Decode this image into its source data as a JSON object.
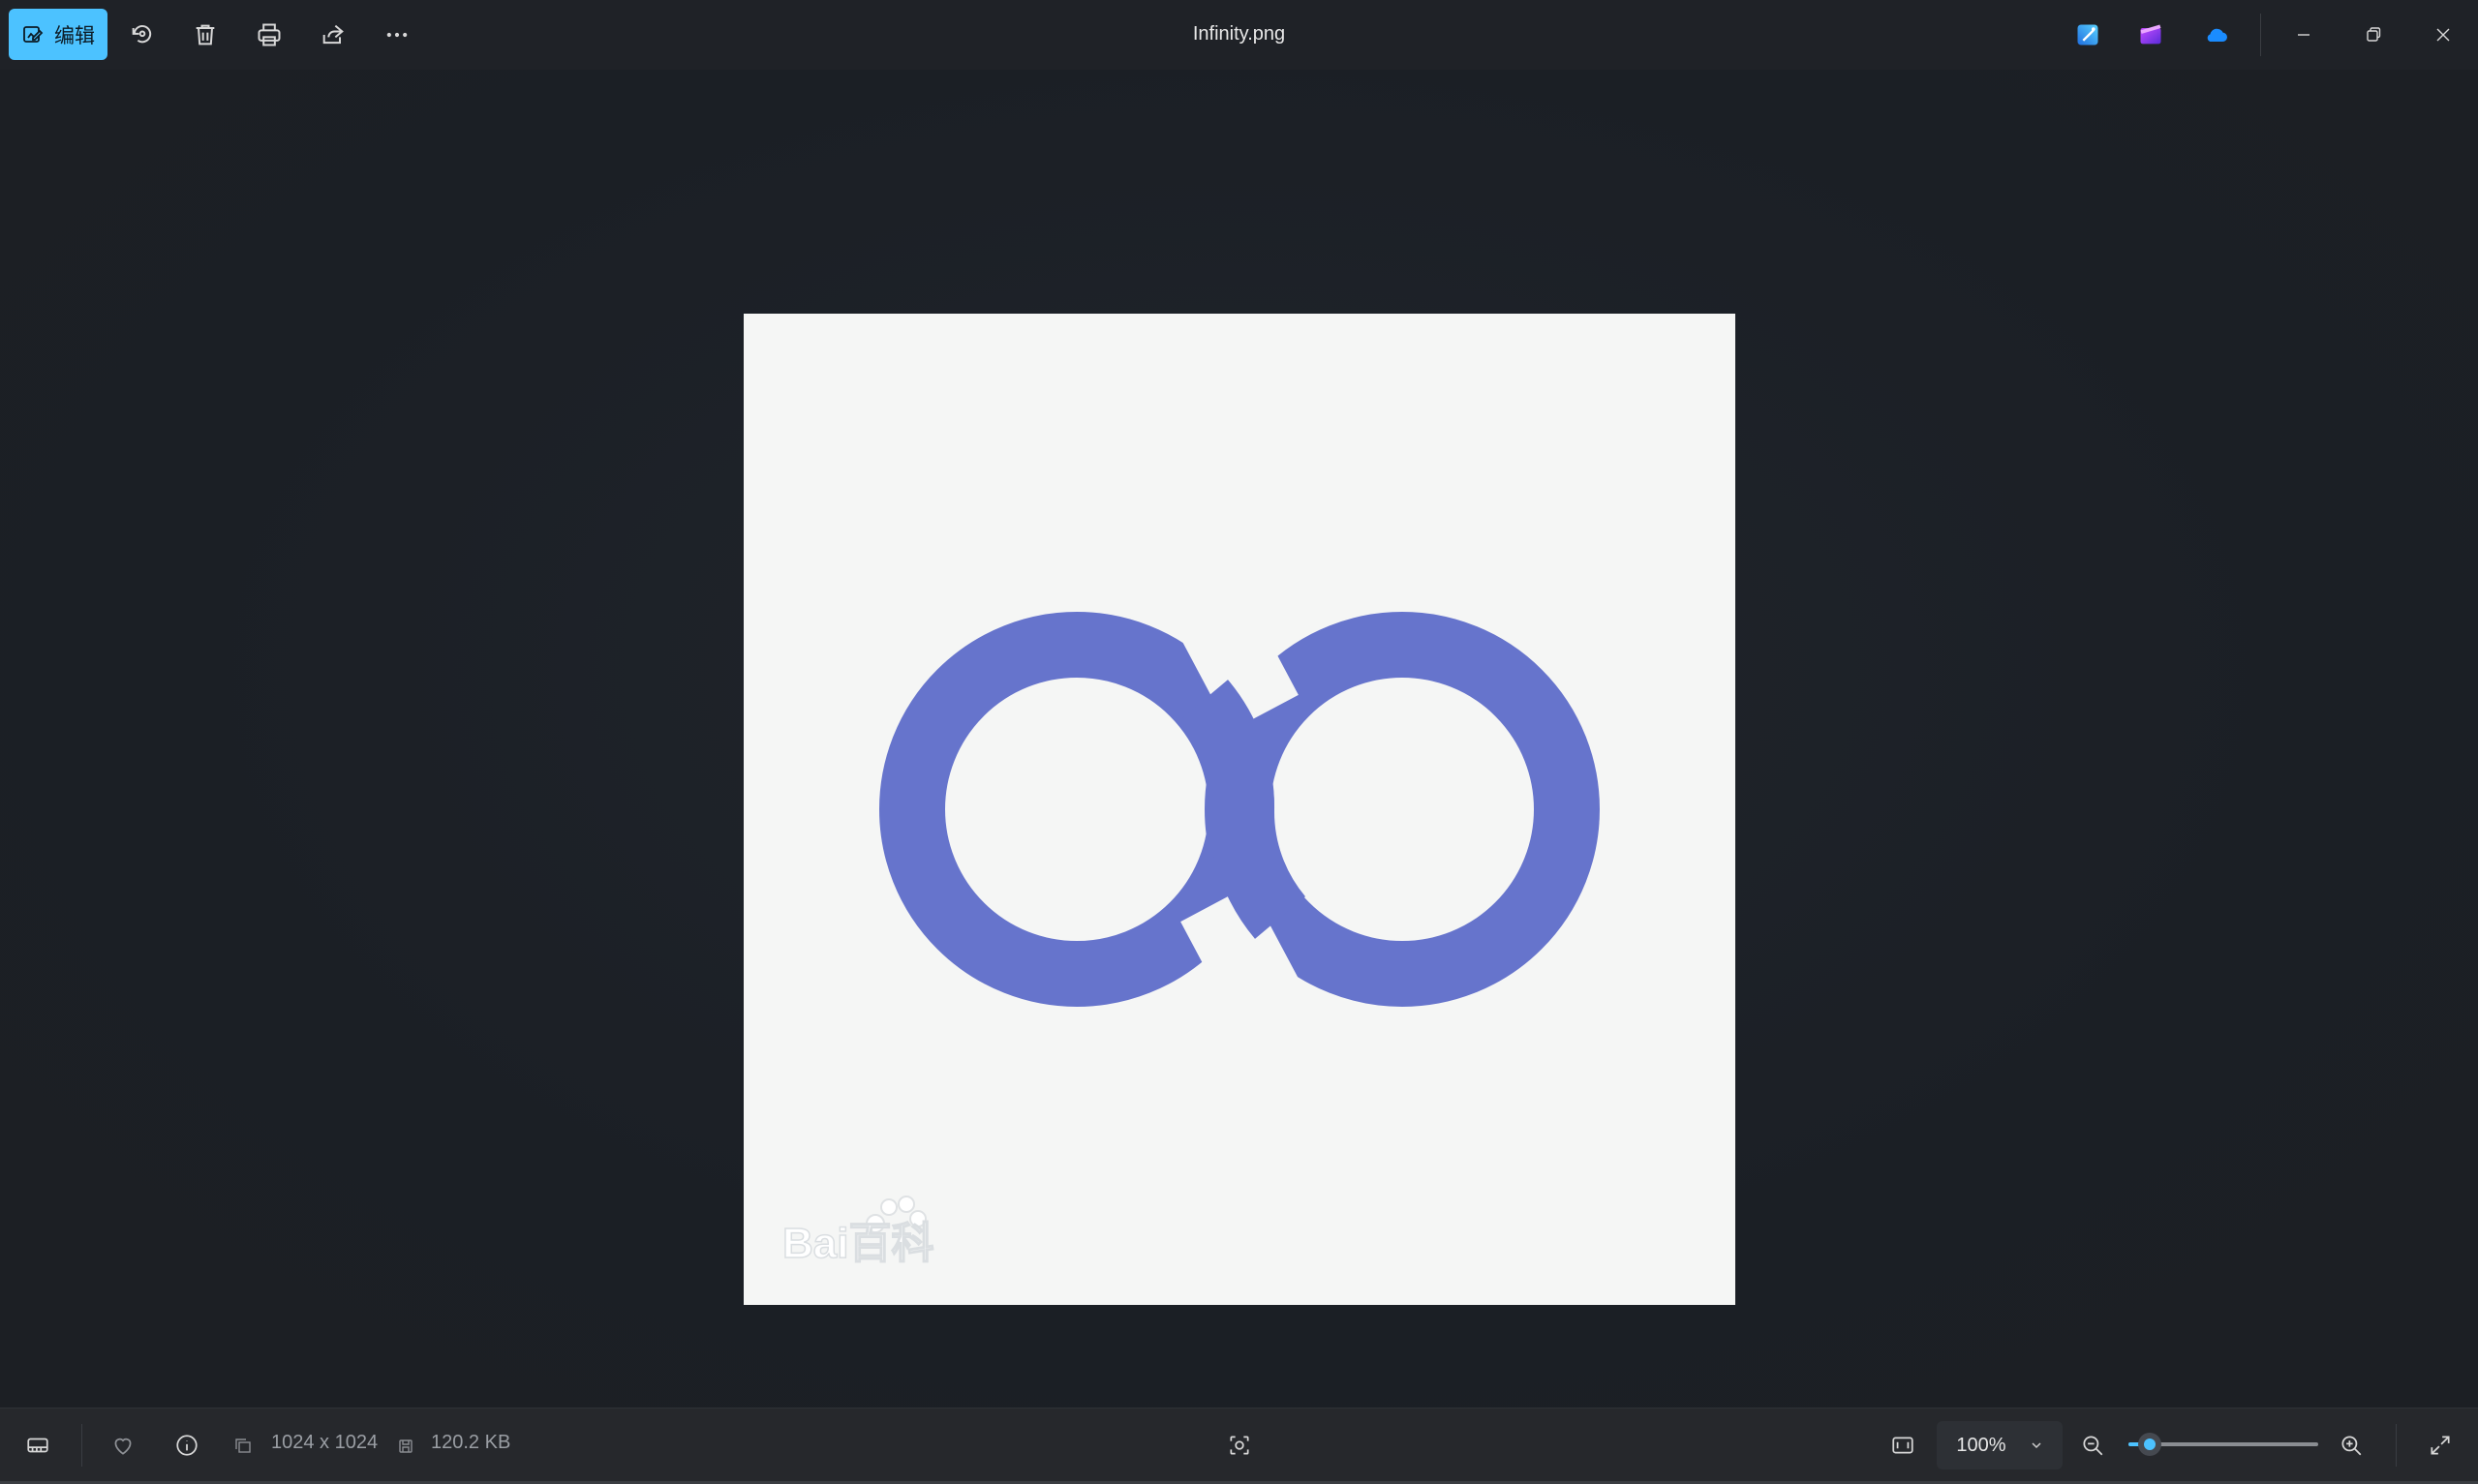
{
  "toolbar": {
    "edit_label": "编辑",
    "file_title": "Infinity.png"
  },
  "image": {
    "watermark": "Bai百科",
    "logo_color": "#6674cc",
    "background_color": "#f5f6f5"
  },
  "status": {
    "dimensions": "1024 x 1024",
    "file_size": "120.2 KB",
    "zoom_value": "100%",
    "zoom_slider_fraction": 0.11
  },
  "colors": {
    "accent": "#4cc2ff"
  }
}
